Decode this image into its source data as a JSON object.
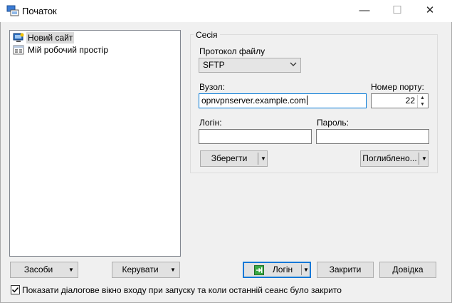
{
  "window": {
    "title": "Початок",
    "controls": {
      "minimize": "—",
      "maximize": "☐",
      "close": "✕"
    }
  },
  "sites": {
    "items": [
      {
        "label": "Новий сайт",
        "icon": "new-site-icon",
        "selected": true
      },
      {
        "label": "Мій робочий простір",
        "icon": "workspace-icon",
        "selected": false
      }
    ]
  },
  "session": {
    "group_label": "Сесія",
    "protocol_label": "Протокол файлу",
    "protocol_value": "SFTP",
    "host_label": "Вузол:",
    "host_value": "opnvpnserver.example.com",
    "port_label": "Номер порту:",
    "port_value": "22",
    "login_label": "Логін:",
    "login_value": "",
    "password_label": "Пароль:",
    "password_value": "",
    "save_label": "Зберегти",
    "advanced_label": "Поглиблено..."
  },
  "bottom": {
    "tools_label": "Засоби",
    "manage_label": "Керувати",
    "login_label": "Логін",
    "close_label": "Закрити",
    "help_label": "Довідка",
    "show_on_startup_label": "Показати діалогове вікно входу при запуску та коли останній сеанс було закрито",
    "show_on_startup_checked": true
  },
  "colors": {
    "accent": "#0078d7",
    "selection": "#d9d9d9",
    "button_face": "#e1e1e1",
    "background": "#f0f0f0"
  }
}
